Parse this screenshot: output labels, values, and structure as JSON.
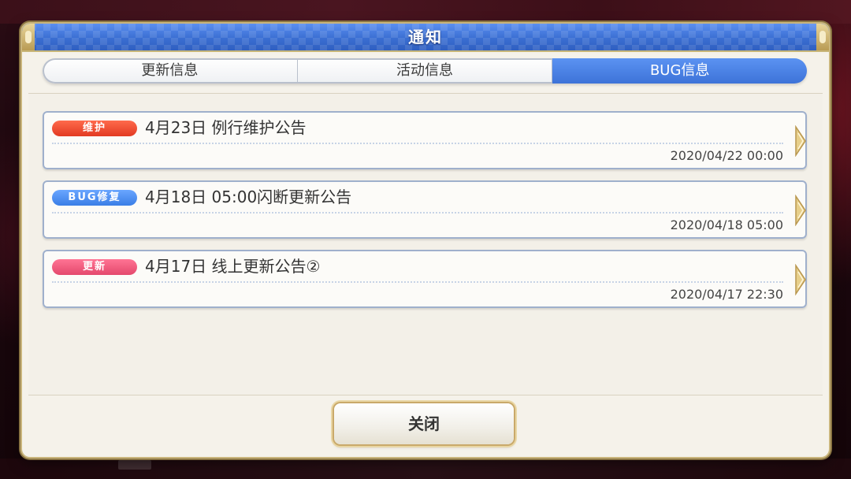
{
  "dialog": {
    "title": "通知"
  },
  "tabs": [
    {
      "label": "更新信息",
      "active": false
    },
    {
      "label": "活动信息",
      "active": false
    },
    {
      "label": "BUG信息",
      "active": true
    }
  ],
  "notices": [
    {
      "badge": "维护",
      "badge_color": "#e8442c",
      "title": "4月23日 例行维护公告",
      "date": "2020/04/22 00:00"
    },
    {
      "badge": "BUG修复",
      "badge_color": "#3f86e6",
      "title": "4月18日 05:00闪断更新公告",
      "date": "2020/04/18 05:00"
    },
    {
      "badge": "更新",
      "badge_color": "#e94e72",
      "title": "4月17日 线上更新公告②",
      "date": "2020/04/17 22:30"
    }
  ],
  "close_button": {
    "label": "关闭"
  },
  "colors": {
    "header_blue": "#3f74d6",
    "active_tab": "#4a82e6",
    "gold_border": "#c9b57c"
  },
  "icons": {
    "notice_arrow": "chevron-right-icon"
  }
}
